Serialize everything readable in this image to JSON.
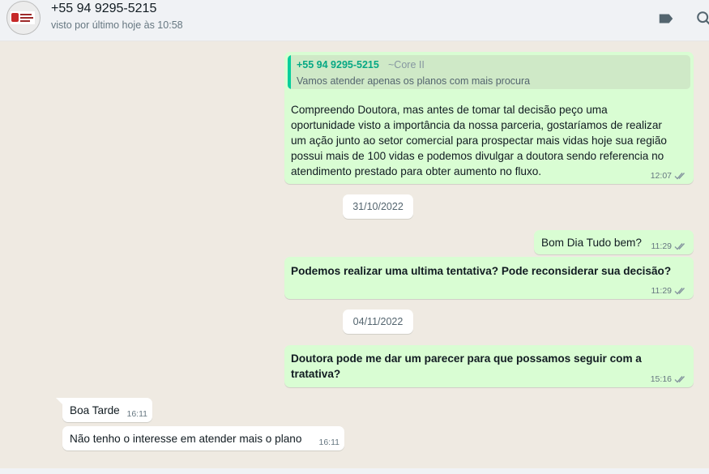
{
  "header": {
    "contact_name": "+55 94 9295-5215",
    "last_seen": "visto por último hoje às 10:58",
    "icons": [
      "label-icon",
      "search-icon"
    ]
  },
  "messages": [
    {
      "direction": "outgoing",
      "quoted": {
        "author": "+55 94 9295-5215",
        "author_sub": "~Core II",
        "text": "Vamos atender apenas os planos com mais procura"
      },
      "lines": [
        "Compreendo Doutora, mas antes de tomar tal decisão peço uma",
        "oportunidade visto a importância da nossa parceria,  gostaríamos de realizar",
        "um ação junto ao setor comercial para prospectar mais vidas hoje sua região",
        "possui mais de 100 vidas  e podemos divulgar a doutora sendo referencia no",
        "atendimento prestado para obter aumento no fluxo."
      ],
      "time": "12:07",
      "status": "read"
    },
    {
      "type": "date",
      "text": "31/10/2022"
    },
    {
      "direction": "outgoing",
      "text": "Bom Dia Tudo bem?",
      "time": "11:29",
      "status": "read"
    },
    {
      "direction": "outgoing",
      "text": "Podemos realizar uma ultima tentativa? Pode  reconsiderar sua decisão?",
      "bold": true,
      "time": "11:29",
      "status": "read"
    },
    {
      "type": "date",
      "text": "04/11/2022"
    },
    {
      "direction": "outgoing",
      "lines": [
        "Doutora pode me dar um parecer para que possamos seguir com a",
        "tratativa?"
      ],
      "bold": true,
      "time": "15:16",
      "status": "read"
    },
    {
      "direction": "incoming",
      "text": "Boa Tarde",
      "time": "16:11"
    },
    {
      "direction": "incoming",
      "text": "Não tenho o interesse em atender mais o plano",
      "time": "16:11"
    }
  ],
  "colors": {
    "outgoing_bubble": "#d9fdd3",
    "incoming_bubble": "#ffffff",
    "chat_background": "#efeae2",
    "quote_accent": "#06cf9c",
    "read_ticks": "#8696a0"
  }
}
